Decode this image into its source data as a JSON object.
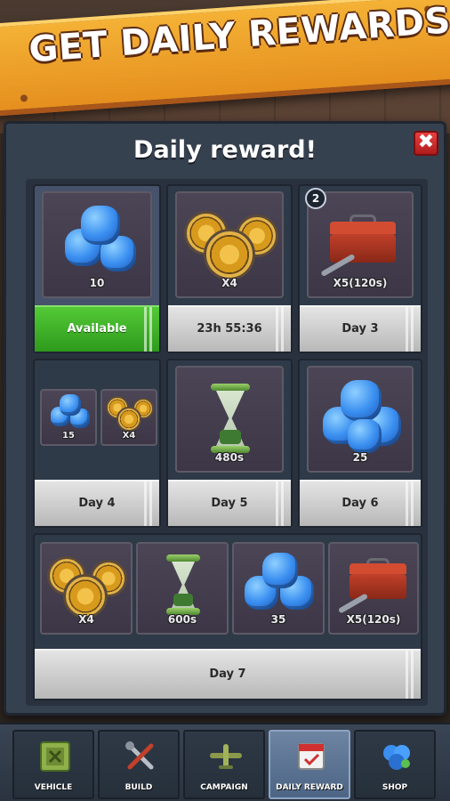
{
  "banner": {
    "title": "GET DAILY REWARDS!"
  },
  "dialog": {
    "title": "Daily reward!",
    "close_symbol": "✖"
  },
  "rewards": [
    {
      "day_button": "Available",
      "state": "available",
      "items": [
        {
          "icon": "gem-icon",
          "label": "10"
        }
      ]
    },
    {
      "day_button": "23h 55:36",
      "state": "countdown",
      "items": [
        {
          "icon": "shield-icon",
          "label": "X4"
        }
      ]
    },
    {
      "day_button": "Day 3",
      "state": "locked",
      "badge": "2",
      "items": [
        {
          "icon": "toolbox-icon",
          "label": "X5(120s)"
        }
      ]
    },
    {
      "day_button": "Day 4",
      "state": "locked",
      "items": [
        {
          "icon": "gem-icon",
          "label": "15"
        },
        {
          "icon": "shield-icon",
          "label": "X4"
        }
      ]
    },
    {
      "day_button": "Day 5",
      "state": "locked",
      "items": [
        {
          "icon": "hourglass-icon",
          "label": "480s"
        }
      ]
    },
    {
      "day_button": "Day 6",
      "state": "locked",
      "items": [
        {
          "icon": "gem-icon",
          "label": "25"
        }
      ]
    },
    {
      "day_button": "Day 7",
      "state": "locked",
      "items": [
        {
          "icon": "shield-icon",
          "label": "X4"
        },
        {
          "icon": "hourglass-icon",
          "label": "600s"
        },
        {
          "icon": "gem-icon",
          "label": "35"
        },
        {
          "icon": "toolbox-icon",
          "label": "X5(120s)"
        }
      ]
    }
  ],
  "nav": [
    {
      "label": "VEHICLE",
      "icon": "vehicle-icon",
      "active": false
    },
    {
      "label": "BUILD",
      "icon": "build-tools-icon",
      "active": false
    },
    {
      "label": "CAMPAIGN",
      "icon": "plane-icon",
      "active": false
    },
    {
      "label": "DAILY REWARD",
      "icon": "calendar-icon",
      "active": true
    },
    {
      "label": "SHOP",
      "icon": "shop-gems-icon",
      "active": false
    }
  ],
  "colors": {
    "available": "#3fb52a",
    "accent_banner": "#f0a22a",
    "close": "#d02a2a"
  }
}
